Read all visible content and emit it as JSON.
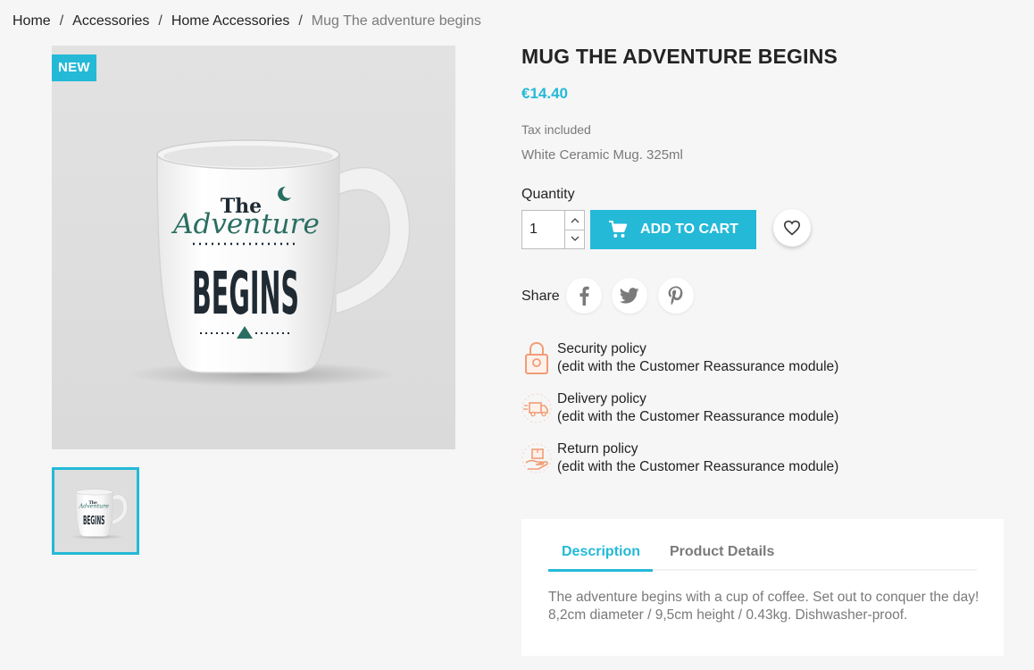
{
  "breadcrumb": {
    "items": [
      "Home",
      "Accessories",
      "Home Accessories"
    ],
    "current": "Mug The adventure begins",
    "separator": "/"
  },
  "product": {
    "badge": "NEW",
    "title": "MUG THE ADVENTURE BEGINS",
    "price": "€14.40",
    "tax": "Tax included",
    "short_description": "White Ceramic Mug. 325ml",
    "quantity_label": "Quantity",
    "quantity_value": "1",
    "add_to_cart": "ADD TO CART",
    "share_label": "Share"
  },
  "mug_print": {
    "line1": "The",
    "line2": "Adventure",
    "line3": "BEGINS"
  },
  "reassurance": [
    {
      "title": "Security policy",
      "subtitle": "(edit with the Customer Reassurance module)",
      "icon": "lock-icon"
    },
    {
      "title": "Delivery policy",
      "subtitle": "(edit with the Customer Reassurance module)",
      "icon": "truck-icon"
    },
    {
      "title": "Return policy",
      "subtitle": "(edit with the Customer Reassurance module)",
      "icon": "return-box-icon"
    }
  ],
  "tabs": {
    "items": [
      "Description",
      "Product Details"
    ],
    "active": "Description",
    "content": "The adventure begins with a cup of coffee. Set out to conquer the day! 8,2cm diameter / 9,5cm height / 0.43kg. Dishwasher-proof."
  },
  "colors": {
    "accent": "#24b9d7",
    "text": "#232323",
    "muted": "#7a7a7a",
    "icon_orange": "#f19d76",
    "mug_green": "#2a6e62"
  }
}
